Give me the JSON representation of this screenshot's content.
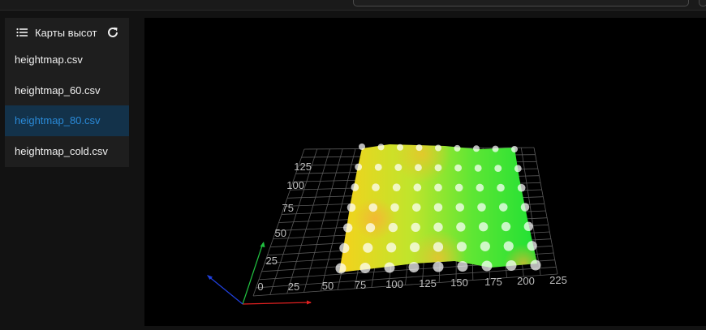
{
  "panel": {
    "title": "Карты высот",
    "files": [
      "heightmap.csv",
      "heightmap_60.csv",
      "heightmap_80.csv",
      "heightmap_cold.csv"
    ],
    "selected_index": 2
  },
  "viewer": {
    "x_ticks": [
      "0",
      "25",
      "50",
      "75",
      "100",
      "125",
      "150",
      "175",
      "200",
      "225"
    ],
    "y_ticks": [
      "25",
      "50",
      "75",
      "100",
      "125"
    ],
    "surface_colors": [
      "#ffd21a",
      "#b8e832",
      "#1ae032"
    ],
    "icons": [
      "list-icon",
      "refresh-icon"
    ]
  }
}
